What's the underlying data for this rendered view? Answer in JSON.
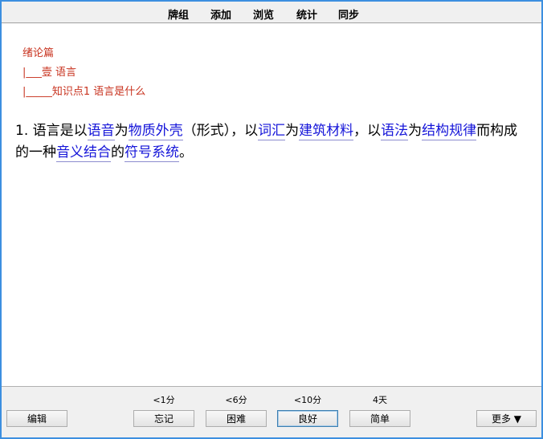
{
  "menu": {
    "items": [
      {
        "label": "牌组"
      },
      {
        "label": "添加"
      },
      {
        "label": "浏览"
      },
      {
        "label": "统计"
      },
      {
        "label": "同步"
      }
    ]
  },
  "breadcrumb": {
    "level1": "绪论篇",
    "level2": "|___壹 语言",
    "level3": "|_____知识点1 语言是什么"
  },
  "card": {
    "t1": "1. 语言是以",
    "c1": "语音",
    "t2": "为",
    "c2": "物质外壳",
    "t3": "（形式），以",
    "c3": "词汇",
    "t4": "为",
    "c4": "建筑材料",
    "t5": "，以",
    "c5": "语法",
    "t6": "为",
    "c6": "结构规律",
    "t7": "而构成的一种",
    "c7": "音义结合",
    "t8": "的",
    "c8": "符号系统",
    "t9": "。"
  },
  "bottom": {
    "edit_label": "编辑",
    "more_label": "更多 ▼",
    "answers": [
      {
        "interval": "<1分",
        "label": "忘记"
      },
      {
        "interval": "<6分",
        "label": "困难"
      },
      {
        "interval": "<10分",
        "label": "良好"
      },
      {
        "interval": "4天",
        "label": "简单"
      }
    ]
  },
  "colors": {
    "window_border": "#3c8fe0",
    "breadcrumb_text": "#c8331f",
    "cloze_text": "#1515d9"
  }
}
